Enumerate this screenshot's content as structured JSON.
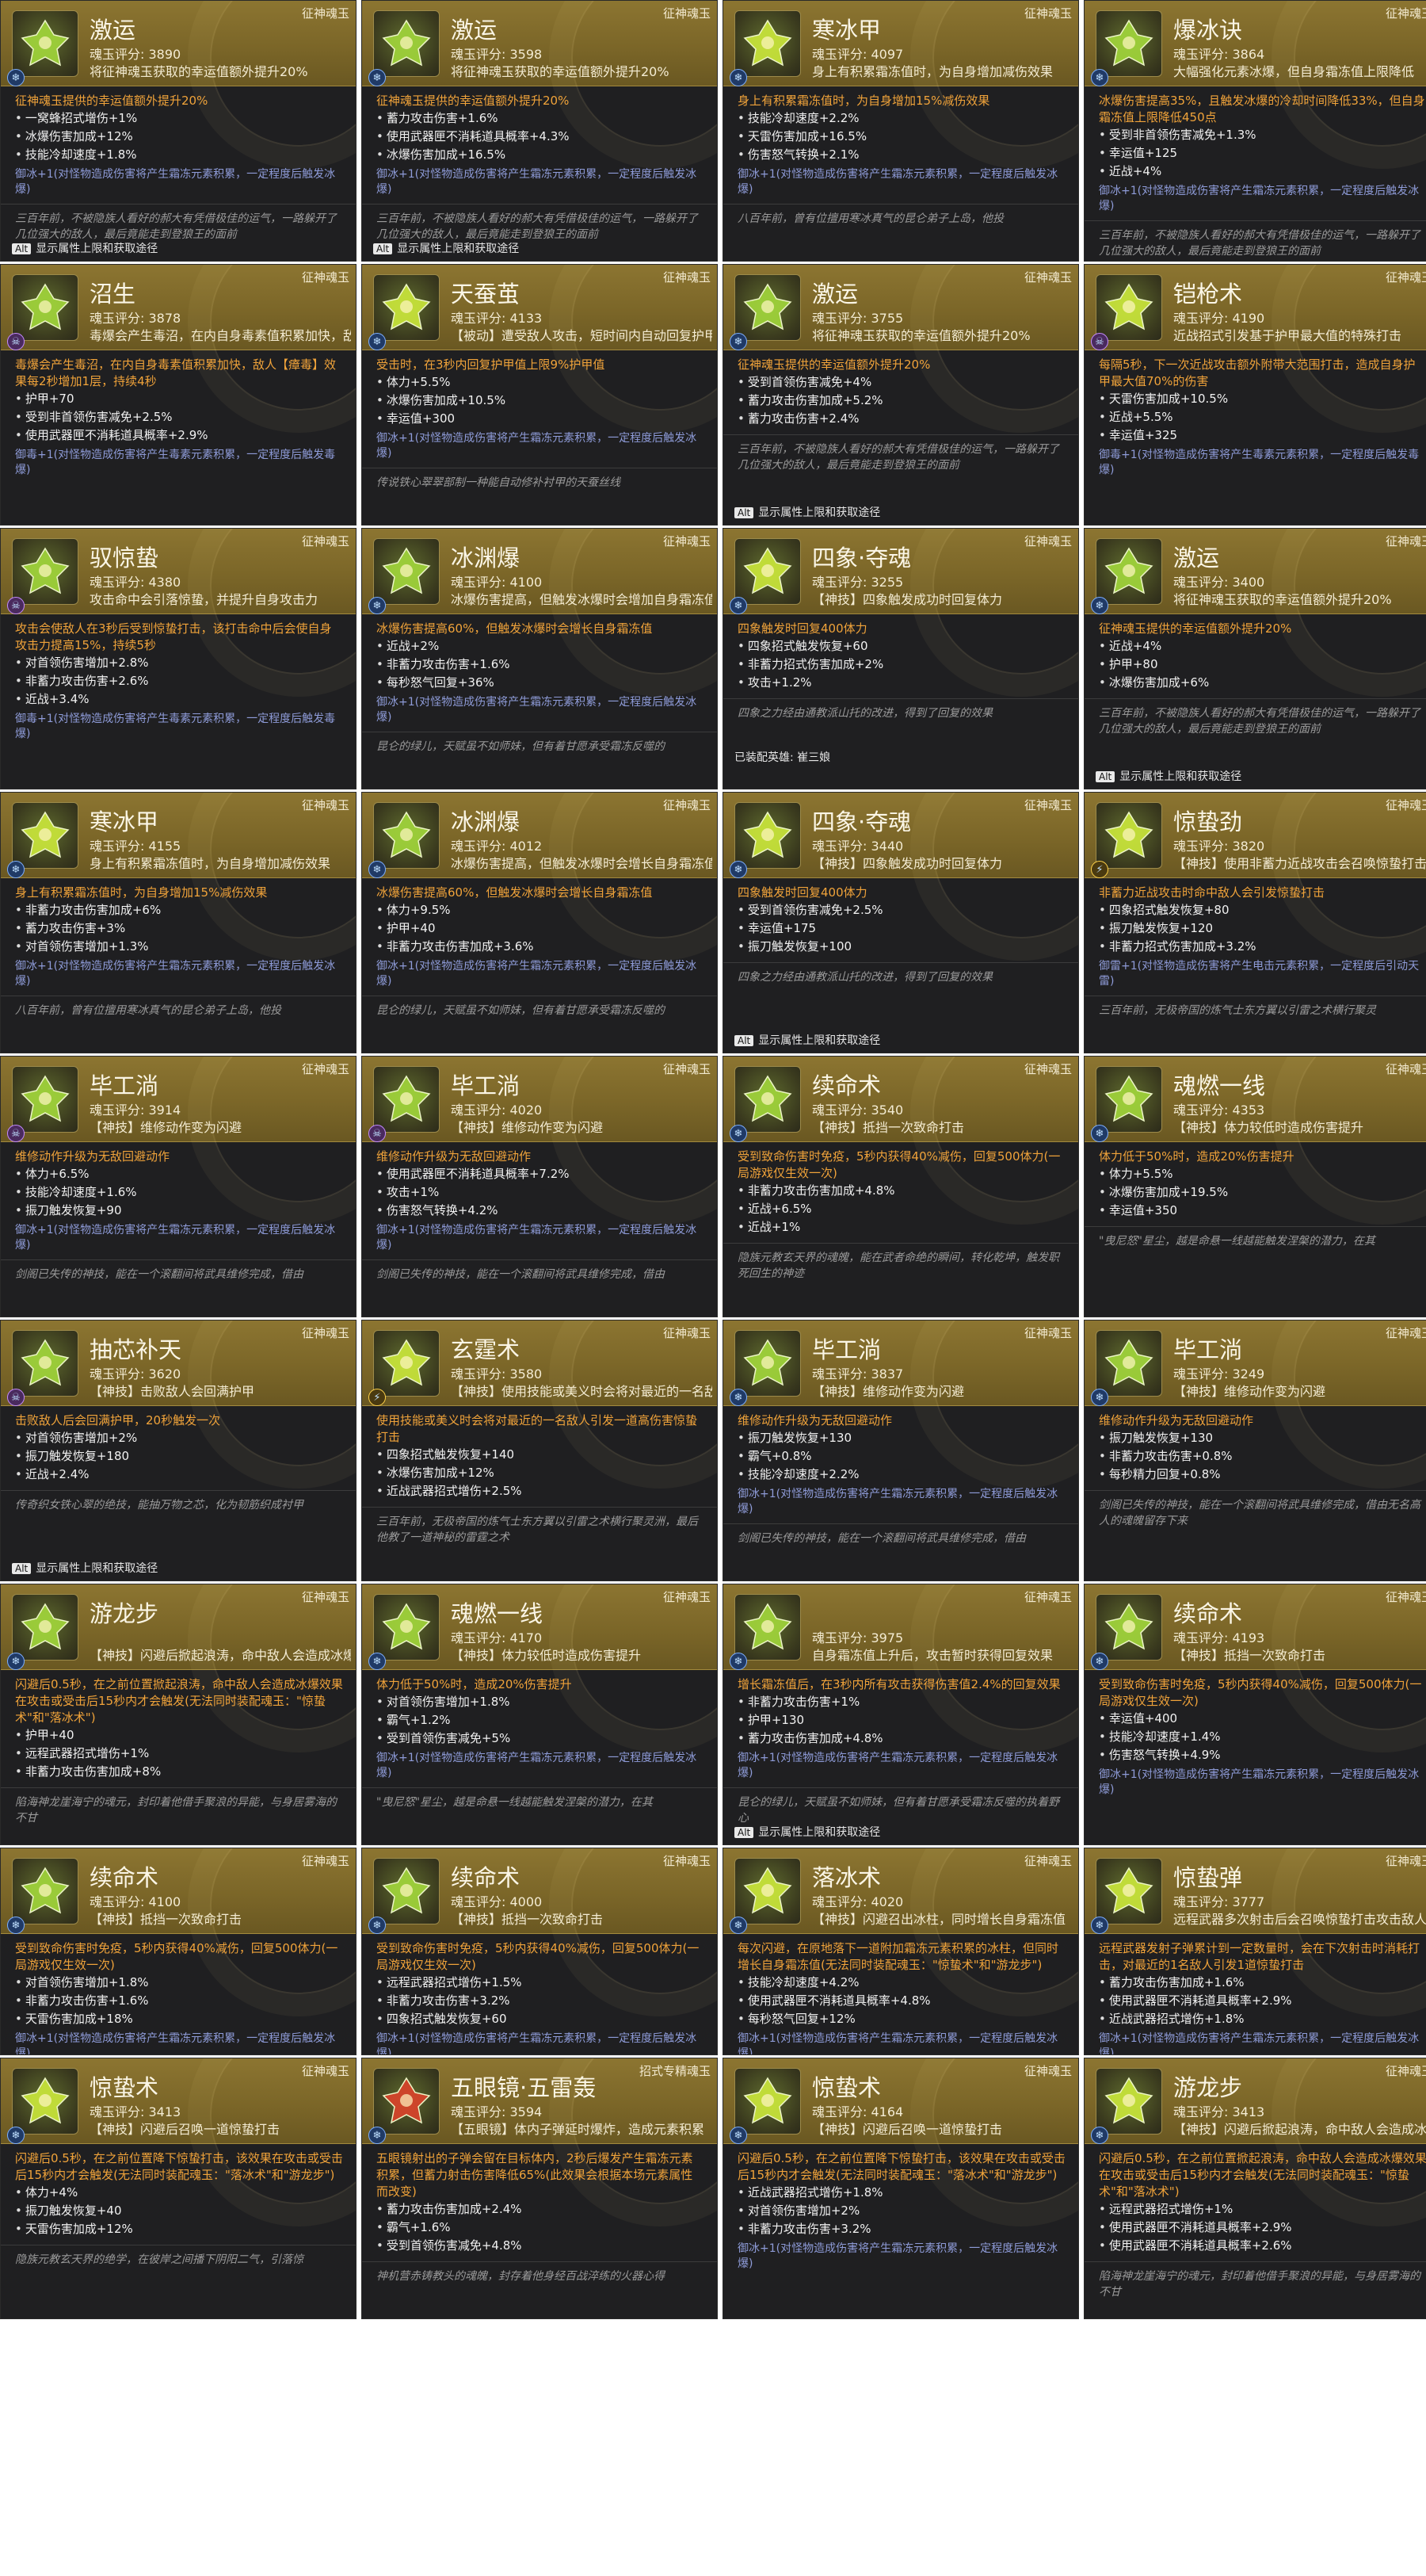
{
  "common": {
    "type": "征神魂玉",
    "score_label": "魂玉评分: ",
    "footer_key": "Alt",
    "footer_text": "显示属性上限和获取途径",
    "equipped_label": "已装配英雄: ",
    "hint_ice": "御冰+1(对怪物造成伤害将产生霜冻元素积累，一定程度后触发冰爆)",
    "hint_ice_short": "御冰+1(对怪物造成伤害将产生霜冻元素积累，一定程度后触发冰爆)",
    "hint_poison": "御毒+1(对怪物造成伤害将产生毒素元素积累，一定程度后触发毒爆)",
    "hint_thunder": "御雷+1(对怪物造成伤害将产生电击元素积累，一定程度后引动天雷)"
  },
  "icon_colors": {
    "green": "#9ed13a",
    "lime": "#c6e23a",
    "red": "#d4442b"
  },
  "cards": [
    {
      "name": "激运",
      "score": "3890",
      "desc": "将征神魂玉获取的幸运值额外提升20%",
      "passive": "征神魂玉提供的幸运值额外提升20%",
      "stats": [
        "一窝蜂招式增伤+1%",
        "冰爆伤害加成+12%",
        "技能冷却速度+1.8%"
      ],
      "hint": "ice",
      "lore": "三百年前，不被隐族人看好的郝大有凭借极佳的运气，一路躲开了几位强大的敌人，最后竟能走到登狼王的面前",
      "foot": true,
      "elem": "ice"
    },
    {
      "name": "激运",
      "score": "3598",
      "desc": "将征神魂玉获取的幸运值额外提升20%",
      "passive": "征神魂玉提供的幸运值额外提升20%",
      "stats": [
        "蓄力攻击伤害+1.6%",
        "使用武器匣不消耗道具概率+4.3%",
        "冰爆伤害加成+16.5%"
      ],
      "hint": "ice",
      "lore": "三百年前，不被隐族人看好的郝大有凭借极佳的运气，一路躲开了几位强大的敌人，最后竟能走到登狼王的面前",
      "foot": true,
      "elem": "ice"
    },
    {
      "name": "寒冰甲",
      "score": "4097",
      "desc": "身上有积累霜冻值时，为自身增加减伤效果",
      "passive": "身上有积累霜冻值时，为自身增加15%减伤效果",
      "stats": [
        "技能冷却速度+2.2%",
        "天雷伤害加成+16.5%",
        "伤害怒气转换+2.1%"
      ],
      "hint": "ice",
      "lore": "八百年前，曾有位擅用寒冰真气的昆仑弟子上岛，他投",
      "foot": false,
      "elem": "ice",
      "lime": true
    },
    {
      "name": "爆冰诀",
      "score": "3864",
      "desc": "大幅强化元素冰爆，但自身霜冻值上限降低",
      "passive": "冰爆伤害提高35%，且触发冰爆的冷却时间降低33%，但自身霜冻值上限降低450点",
      "stats": [
        "受到非首领伤害减免+1.3%",
        "幸运值+125",
        "近战+4%"
      ],
      "hint": "ice",
      "lore": "三百年前，不被隐族人看好的郝大有凭借极佳的运气，一路躲开了几位强大的敌人，最后竟能走到登狼王的面前",
      "foot": false,
      "elem": "ice"
    },
    {
      "name": "沼生",
      "score": "3878",
      "desc": "毒爆会产生毒沼，在内自身毒素值积累加快，敌人【瘴毒】",
      "passive": "毒爆会产生毒沼，在内自身毒素值积累加快，敌人【瘴毒】效果每2秒增加1层，持续4秒",
      "stats": [
        "护甲+70",
        "受到非首领伤害减免+2.5%",
        "使用武器匣不消耗道具概率+2.9%"
      ],
      "hint": "poison",
      "lore": "",
      "foot": false,
      "elem": "poison"
    },
    {
      "name": "天蚕茧",
      "score": "4133",
      "desc": "【被动】遭受敌人攻击，短时间内自动回复护甲值",
      "passive": "受击时，在3秒内回复护甲值上限9%护甲值",
      "stats": [
        "体力+5.5%",
        "冰爆伤害加成+10.5%",
        "幸运值+300"
      ],
      "hint": "ice",
      "lore": "传说铁心翠翠部制一种能自动修补衬甲的天蚕丝线",
      "foot": false,
      "elem": "ice",
      "lime": true
    },
    {
      "name": "激运",
      "score": "3755",
      "desc": "将征神魂玉获取的幸运值额外提升20%",
      "passive": "征神魂玉提供的幸运值额外提升20%",
      "stats": [
        "受到首领伤害减免+4%",
        "蓄力攻击伤害加成+5.2%",
        "蓄力攻击伤害+2.4%"
      ],
      "hint": "",
      "lore": "三百年前，不被隐族人看好的郝大有凭借极佳的运气，一路躲开了几位强大的敌人，最后竟能走到登狼王的面前",
      "foot": true,
      "elem": "ice"
    },
    {
      "name": "铠枪术",
      "score": "4190",
      "desc": "近战招式引发基于护甲最大值的特殊打击",
      "passive": "每隔5秒，下一次近战攻击额外附带大范围打击，造成自身护甲最大值70%的伤害",
      "stats": [
        "天雷伤害加成+10.5%",
        "近战+5.5%",
        "幸运值+325"
      ],
      "hint": "poison",
      "lore": "",
      "foot": false,
      "elem": "poison",
      "lime": true
    },
    {
      "name": "驭惊蛰",
      "score": "4380",
      "desc": "攻击命中会引落惊蛰，并提升自身攻击力",
      "passive": "攻击会使敌人在3秒后受到惊蛰打击，该打击命中后会使自身攻击力提高15%，持续5秒",
      "stats": [
        "对首领伤害增加+2.8%",
        "非蓄力攻击伤害+2.6%",
        "近战+3.4%"
      ],
      "hint": "poison",
      "lore": "",
      "foot": false,
      "elem": "poison"
    },
    {
      "name": "冰渊爆",
      "score": "4100",
      "desc": "冰爆伤害提高，但触发冰爆时会增加自身霜冻值",
      "passive": "冰爆伤害提高60%，但触发冰爆时会增长自身霜冻值",
      "stats": [
        "近战+2%",
        "非蓄力攻击伤害+1.6%",
        "每秒怒气回复+36%"
      ],
      "hint": "ice",
      "lore": "昆仑的绿儿，天赋虽不如师妹，但有着甘愿承受霜冻反噬的",
      "foot": false,
      "elem": "ice"
    },
    {
      "name": "四象·夺魂",
      "score": "3255",
      "desc": "【神技】四象触发成功时回复体力",
      "passive": "四象触发时回复400体力",
      "stats": [
        "四象招式触发恢复+60",
        "非蓄力招式伤害加成+2%",
        "攻击+1.2%"
      ],
      "hint": "",
      "lore": "四象之力经由通教派山托的改进，得到了回复的效果",
      "foot": false,
      "equipped": "崔三娘",
      "elem": "ice",
      "lime": true
    },
    {
      "name": "激运",
      "score": "3400",
      "desc": "将征神魂玉获取的幸运值额外提升20%",
      "passive": "征神魂玉提供的幸运值额外提升20%",
      "stats": [
        "近战+4%",
        "护甲+80",
        "冰爆伤害加成+6%"
      ],
      "hint": "",
      "lore": "三百年前，不被隐族人看好的郝大有凭借极佳的运气，一路躲开了几位强大的敌人，最后竟能走到登狼王的面前",
      "foot": true,
      "elem": "ice"
    },
    {
      "name": "寒冰甲",
      "score": "4155",
      "desc": "身上有积累霜冻值时，为自身增加减伤效果",
      "passive": "身上有积累霜冻值时，为自身增加15%减伤效果",
      "stats": [
        "非蓄力攻击伤害加成+6%",
        "蓄力攻击伤害+3%",
        "对首领伤害增加+1.3%"
      ],
      "hint": "ice",
      "lore": "八百年前，曾有位擅用寒冰真气的昆仑弟子上岛，他投",
      "foot": false,
      "elem": "ice",
      "lime": true
    },
    {
      "name": "冰渊爆",
      "score": "4012",
      "desc": "冰爆伤害提高，但触发冰爆时会增长自身霜冻值",
      "passive": "冰爆伤害提高60%，但触发冰爆时会增长自身霜冻值",
      "stats": [
        "体力+9.5%",
        "护甲+40",
        "非蓄力攻击伤害加成+3.6%"
      ],
      "hint": "ice",
      "lore": "昆仑的绿儿，天赋虽不如师妹，但有着甘愿承受霜冻反噬的",
      "foot": false,
      "elem": "ice"
    },
    {
      "name": "四象·夺魂",
      "score": "3440",
      "desc": "【神技】四象触发成功时回复体力",
      "passive": "四象触发时回复400体力",
      "stats": [
        "受到首领伤害减免+2.5%",
        "幸运值+175",
        "振刀触发恢复+100"
      ],
      "hint": "",
      "lore": "四象之力经由通教派山托的改进，得到了回复的效果",
      "foot": true,
      "elem": "ice",
      "lime": true
    },
    {
      "name": "惊蛰劲",
      "score": "3820",
      "desc": "【神技】使用非蓄力近战攻击会召唤惊蛰打击",
      "passive": "非蓄力近战攻击时命中敌人会引发惊蛰打击",
      "stats": [
        "四象招式触发恢复+80",
        "振刀触发恢复+120",
        "非蓄力招式伤害加成+3.2%"
      ],
      "hint": "thunder",
      "lore": "三百年前，无极帝国的炼气士东方翼以引雷之术横行聚灵",
      "foot": false,
      "elem": "thunder",
      "lime": true
    },
    {
      "name": "毕工淌",
      "score": "3914",
      "desc": "【神技】维修动作变为闪避",
      "passive": "维修动作升级为无敌回避动作",
      "stats": [
        "体力+6.5%",
        "技能冷却速度+1.6%",
        "振刀触发恢复+90"
      ],
      "hint": "ice",
      "lore": "剑阁已失传的神技，能在一个滚翻间将武具维修完成，借由",
      "foot": false,
      "elem": "poison"
    },
    {
      "name": "毕工淌",
      "score": "4020",
      "desc": "【神技】维修动作变为闪避",
      "passive": "维修动作升级为无敌回避动作",
      "stats": [
        "使用武器匣不消耗道具概率+7.2%",
        "攻击+1%",
        "伤害怒气转换+4.2%"
      ],
      "hint": "ice",
      "lore": "剑阁已失传的神技，能在一个滚翻间将武具维修完成，借由",
      "foot": false,
      "elem": "poison"
    },
    {
      "name": "续命术",
      "score": "3540",
      "desc": "【神技】抵挡一次致命打击",
      "passive": "受到致命伤害时免疫，5秒内获得40%减伤，回复500体力(一局游戏仅生效一次)",
      "stats": [
        "非蓄力攻击伤害加成+4.8%",
        "近战+6.5%",
        "近战+1%"
      ],
      "hint": "",
      "lore": "隐族元教玄天界的魂魄，能在武者命绝的瞬间，转化乾坤，触发职死回生的神迹",
      "foot": false,
      "elem": "ice"
    },
    {
      "name": "魂燃一线",
      "score": "4353",
      "desc": "【神技】体力较低时造成伤害提升",
      "passive": "体力低于50%时，造成20%伤害提升",
      "stats": [
        "体力+5.5%",
        "冰爆伤害加成+19.5%",
        "幸运值+350"
      ],
      "hint": "",
      "lore": "\"曳尼怒\"星尘，越是命悬一线越能触发涅槃的潜力，在其",
      "foot": false,
      "elem": "ice"
    },
    {
      "name": "抽芯补天",
      "score": "3620",
      "desc": "【神技】击败敌人会回满护甲",
      "passive": "击败敌人后会回满护甲，20秒触发一次",
      "stats": [
        "对首领伤害增加+2%",
        "振刀触发恢复+180",
        "近战+2.4%"
      ],
      "hint": "",
      "lore": "传奇织女铁心翠的绝技，能抽万物之芯，化为韧筋织成衬甲",
      "foot": true,
      "elem": "poison"
    },
    {
      "name": "玄霆术",
      "score": "3580",
      "desc": "【神技】使用技能或美义时会将对最近的一名敌人引发一道高伤害惊蛰打击",
      "passive": "使用技能或美义时会将对最近的一名敌人引发一道高伤害惊蛰打击",
      "stats": [
        "四象招式触发恢复+140",
        "冰爆伤害加成+12%",
        "近战武器招式增伤+2.5%"
      ],
      "hint": "",
      "lore": "三百年前，无极帝国的炼气士东方翼以引雷之术横行聚灵洲，最后他教了一道神秘的雷霆之术",
      "foot": false,
      "elem": "thunder",
      "lime": true
    },
    {
      "name": "毕工淌",
      "score": "3837",
      "desc": "【神技】维修动作变为闪避",
      "passive": "维修动作升级为无敌回避动作",
      "stats": [
        "振刀触发恢复+130",
        "霸气+0.8%",
        "技能冷却速度+2.2%"
      ],
      "hint": "ice",
      "lore": "剑阁已失传的神技，能在一个滚翻间将武具维修完成，借由",
      "foot": false,
      "elem": "ice"
    },
    {
      "name": "毕工淌",
      "score": "3249",
      "desc": "【神技】维修动作变为闪避",
      "passive": "维修动作升级为无敌回避动作",
      "stats": [
        "振刀触发恢复+130",
        "非蓄力攻击伤害+0.8%",
        "每秒精力回复+0.8%"
      ],
      "hint": "",
      "lore": "剑阁已失传的神技，能在一个滚翻间将武具维修完成，借由无名高人的魂魄留存下来",
      "foot": false,
      "elem": "ice"
    },
    {
      "name": "游龙步",
      "score": "",
      "desc": "【神技】闪避后掀起浪涛，命中敌人会造成冰爆",
      "passive": "闪避后0.5秒，在之前位置掀起浪涛，命中敌人会造成冰爆效果在攻击或受击后15秒内才会触发(无法同时装配魂玉：\"惊蛰术\"和\"落冰术\")",
      "stats": [
        "护甲+40",
        "远程武器招式增伤+1%",
        "非蓄力攻击伤害加成+8%"
      ],
      "hint": "",
      "lore": "陷海神龙崖海宁的魂元，封印着他借手聚浪的异能，与身居雾海的不甘",
      "foot": false,
      "elem": "ice"
    },
    {
      "name": "魂燃一线",
      "score": "4170",
      "desc": "【神技】体力较低时造成伤害提升",
      "passive": "体力低于50%时，造成20%伤害提升",
      "stats": [
        "对首领伤害增加+1.8%",
        "霸气+1.2%",
        "受到首领伤害减免+5%"
      ],
      "hint": "ice",
      "lore": "\"曳尼怒\"星尘，越是命悬一线越能触发涅槃的潜力，在其",
      "foot": false,
      "elem": "ice"
    },
    {
      "name": "",
      "score": "3975",
      "desc": "自身霜冻值上升后，攻击暂时获得回复效果",
      "passive": "增长霜冻值后，在3秒内所有攻击获得伤害值2.4%的回复效果",
      "stats": [
        "非蓄力攻击伤害+1%",
        "护甲+130",
        "蓄力攻击伤害加成+4.8%"
      ],
      "hint": "ice",
      "lore": "昆仑的绿儿，天赋虽不如师妹，但有着甘愿承受霜冻反噬的执着野心",
      "foot": true,
      "elem": "ice"
    },
    {
      "name": "续命术",
      "score": "4193",
      "desc": "【神技】抵挡一次致命打击",
      "passive": "受到致命伤害时免疫，5秒内获得40%减伤，回复500体力(一局游戏仅生效一次)",
      "stats": [
        "幸运值+400",
        "技能冷却速度+1.4%",
        "伤害怒气转换+4.9%"
      ],
      "hint": "ice",
      "lore": "",
      "foot": false,
      "elem": "ice"
    },
    {
      "name": "续命术",
      "score": "4100",
      "desc": "【神技】抵挡一次致命打击",
      "passive": "受到致命伤害时免疫，5秒内获得40%减伤，回复500体力(一局游戏仅生效一次)",
      "stats": [
        "对首领伤害增加+1.8%",
        "非蓄力攻击伤害+1.6%",
        "天雷伤害加成+18%"
      ],
      "hint": "ice",
      "lore": "",
      "foot": false,
      "elem": "ice"
    },
    {
      "name": "续命术",
      "score": "4000",
      "desc": "【神技】抵挡一次致命打击",
      "passive": "受到致命伤害时免疫，5秒内获得40%减伤，回复500体力(一局游戏仅生效一次)",
      "stats": [
        "远程武器招式增伤+1.5%",
        "非蓄力攻击伤害+3.2%",
        "四象招式触发恢复+60"
      ],
      "hint": "ice",
      "lore": "",
      "foot": false,
      "elem": "ice"
    },
    {
      "name": "落冰术",
      "score": "4020",
      "desc": "【神技】闪避召出冰柱，同时增长自身霜冻值",
      "passive": "每次闪避，在原地落下一道附加霜冻元素积累的冰柱，但同时增长自身霜冻值(无法同时装配魂玉：\"惊蛰术\"和\"游龙步\")",
      "stats": [
        "技能冷却速度+4.2%",
        "使用武器匣不消耗道具概率+4.8%",
        "每秒怒气回复+12%"
      ],
      "hint": "ice",
      "lore": "",
      "foot": false,
      "elem": "ice",
      "lime": true
    },
    {
      "name": "惊蛰弹",
      "score": "3777",
      "desc": "远程武器多次射击后会召唤惊蛰打击攻击敌人",
      "passive": "远程武器发射子弹累计到一定数量时，会在下次射击时消耗打击，对最近的1名敌人引发1道惊蛰打击",
      "stats": [
        "蓄力攻击伤害加成+1.6%",
        "使用武器匣不消耗道具概率+2.9%",
        "近战武器招式增伤+1.8%"
      ],
      "hint": "ice",
      "lore": "",
      "foot": false,
      "elem": "ice",
      "lime": true
    },
    {
      "name": "惊蛰术",
      "score": "3413",
      "desc": "【神技】闪避后召唤一道惊蛰打击",
      "passive": "闪避后0.5秒，在之前位置降下惊蛰打击，该效果在攻击或受击后15秒内才会触发(无法同时装配魂玉：\"落冰术\"和\"游龙步\")",
      "stats": [
        "体力+4%",
        "振刀触发恢复+40",
        "天雷伤害加成+12%"
      ],
      "hint": "",
      "lore": "隐族元教玄天界的绝学，在彼岸之间播下阴阳二气，引落惊",
      "foot": false,
      "elem": "ice",
      "lime": true
    },
    {
      "name": "五眼镜·五雷轰",
      "score": "3594",
      "desc": "【五眼镜】体内子弹延时爆炸，造成元素积累",
      "passive": "五眼镜射出的子弹会留在目标体内，2秒后爆发产生霜冻元素积累，但蓄力射击伤害降低65%(此效果会根据本场元素属性而改变)",
      "stats": [
        "蓄力攻击伤害加成+2.4%",
        "霸气+1.6%",
        "受到首领伤害减免+4.8%"
      ],
      "hint": "",
      "lore": "神机营赤铸教头的魂魄，封存着他身经百战淬练的火器心得",
      "foot": false,
      "elem": "ice",
      "red": true,
      "tag": "招式专精魂玉"
    },
    {
      "name": "惊蛰术",
      "score": "4164",
      "desc": "【神技】闪避后召唤一道惊蛰打击",
      "passive": "闪避后0.5秒，在之前位置降下惊蛰打击，该效果在攻击或受击后15秒内才会触发(无法同时装配魂玉：\"落冰术\"和\"游龙步\")",
      "stats": [
        "近战武器招式增伤+1.8%",
        "对首领伤害增加+2%",
        "非蓄力攻击伤害+3.2%"
      ],
      "hint": "ice",
      "lore": "",
      "foot": false,
      "elem": "ice",
      "lime": true
    },
    {
      "name": "游龙步",
      "score": "3413",
      "desc": "【神技】闪避后掀起浪涛，命中敌人会造成冰爆",
      "passive": "闪避后0.5秒，在之前位置掀起浪涛，命中敌人会造成冰爆效果在攻击或受击后15秒内才会触发(无法同时装配魂玉：\"惊蛰术\"和\"落冰术\")",
      "stats": [
        "远程武器招式增伤+1%",
        "使用武器匣不消耗道具概率+2.9%",
        "使用武器匣不消耗道具概率+2.6%"
      ],
      "hint": "",
      "lore": "陷海神龙崖海宁的魂元，封印着他借手聚浪的异能，与身居雾海的不甘",
      "foot": false,
      "elem": "ice",
      "lime": true
    }
  ]
}
